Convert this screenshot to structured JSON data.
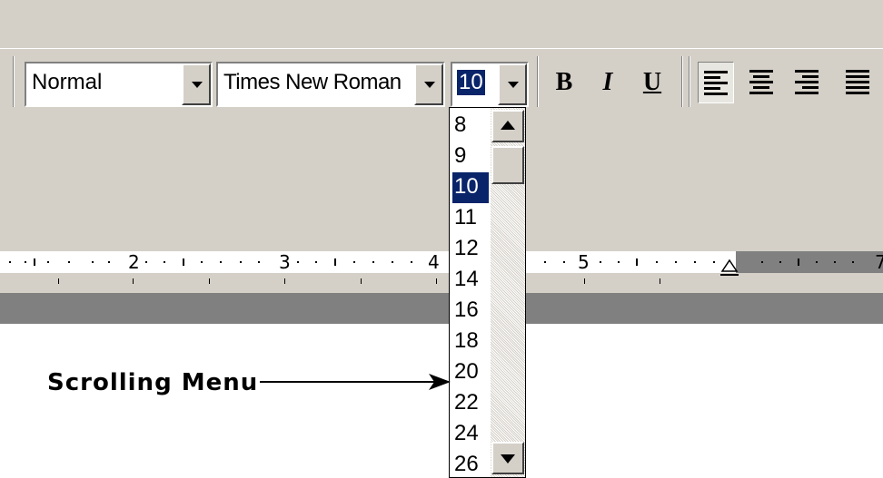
{
  "toolbar": {
    "style": {
      "value": "Normal"
    },
    "font": {
      "value": "Times New Roman"
    },
    "size": {
      "value": "10"
    },
    "bold_label": "B",
    "italic_label": "I",
    "underline_label": "U",
    "align_left_pressed": true
  },
  "ruler": {
    "numbers": [
      "2",
      "3",
      "4",
      "5",
      "7"
    ]
  },
  "size_menu": {
    "items": [
      "8",
      "9",
      "10",
      "11",
      "12",
      "14",
      "16",
      "18",
      "20",
      "22",
      "24",
      "26"
    ],
    "selected": "10"
  },
  "annotation": {
    "label": "Scrolling Menu"
  },
  "colors": {
    "face": "#d4d0c8",
    "selection": "#0a246a",
    "dark_band": "#808080"
  },
  "icons": [
    "chevron-down-icon",
    "bold-icon",
    "italic-icon",
    "underline-icon",
    "align-left-icon",
    "align-center-icon",
    "align-right-icon",
    "justify-icon",
    "scroll-up-icon",
    "scroll-down-icon",
    "indent-marker-icon",
    "arrow-icon"
  ]
}
